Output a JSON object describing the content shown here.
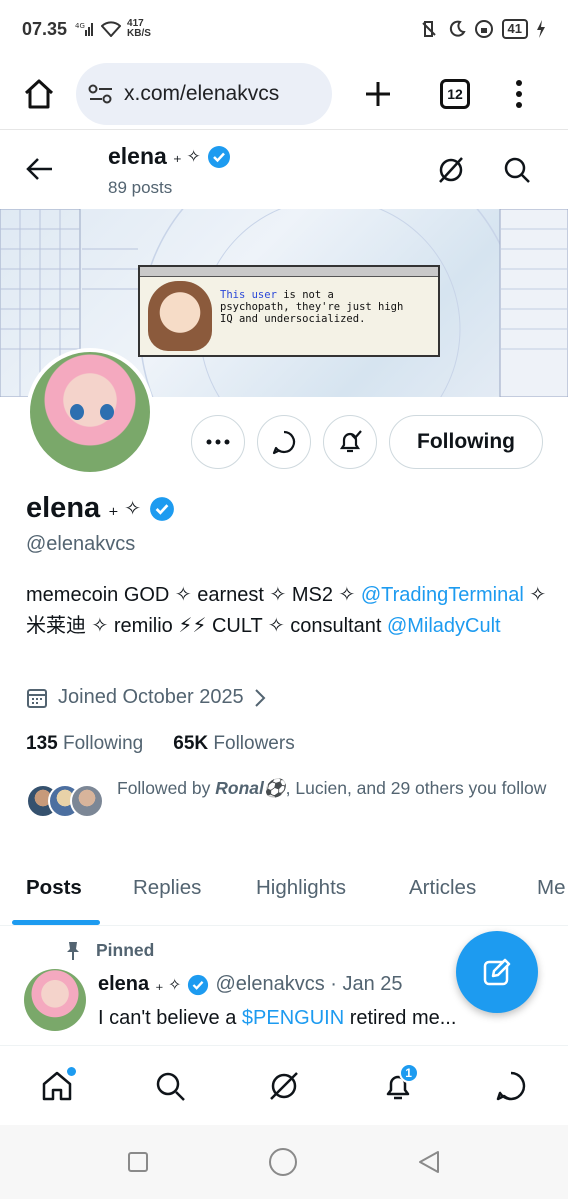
{
  "status_bar": {
    "time": "07.35",
    "net_speed_value": "417",
    "net_speed_unit": "KB/S",
    "battery": "41"
  },
  "browser": {
    "url": "x.com/elenakvcs",
    "tab_count": "12"
  },
  "profile_header": {
    "name": "elena",
    "name_suffix": "₊ ✧",
    "posts_count": "89 posts"
  },
  "banner": {
    "dialog_line1_a": "This user",
    "dialog_line1_b": " is not a",
    "dialog_line2": "psychopath, they're just high",
    "dialog_line3": "IQ and undersocialized."
  },
  "actions": {
    "following_label": "Following"
  },
  "profile": {
    "name": "elena",
    "name_suffix": "₊ ✧",
    "handle": "@elenakvcs",
    "bio_part1": "memecoin GOD ✧ earnest ✧ MS2 ✧ ",
    "bio_link1": "@TradingTerminal",
    "bio_part2": " ✧ 米莱迪 ✧ remilio ⚡⚡ CULT ✧ consultant ",
    "bio_link2": "@MiladyCult",
    "joined": "Joined October 2025",
    "following_count": "135",
    "following_label": "Following",
    "followers_count": "65K",
    "followers_label": "Followers",
    "followed_by_prefix": "Followed by ",
    "followed_by_name": "Ronal⚽",
    "followed_by_rest": ", Lucien, and 29 others you follow"
  },
  "tabs": [
    "Posts",
    "Replies",
    "Highlights",
    "Articles",
    "Me"
  ],
  "pinned_post": {
    "pinned_label": "Pinned",
    "author_name": "elena",
    "author_suffix": "₊ ✧",
    "author_handle_date": "@elenakvcs · Jan 25",
    "text_prefix": "I can't believe a ",
    "text_link": "$PENGUIN",
    "text_suffix": " retired me..."
  },
  "bottom_nav": {
    "notifications_badge": "1"
  },
  "colors": {
    "accent": "#1d9bf0",
    "text": "#0f1419",
    "muted": "#536471"
  }
}
